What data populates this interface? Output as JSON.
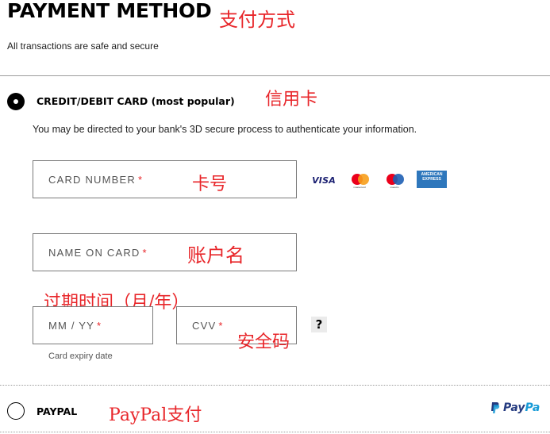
{
  "header": {
    "title": "PAYMENT METHOD",
    "title_annotation": "支付方式",
    "subtitle": "All transactions are safe and secure"
  },
  "credit_card_option": {
    "label": "CREDIT/DEBIT CARD (most popular)",
    "annotation": "信用卡",
    "selected": true,
    "note": "You may be directed to your bank's 3D secure process to authenticate your information."
  },
  "fields": {
    "card_number": {
      "placeholder": "CARD NUMBER",
      "required_mark": "*",
      "annotation": "卡号"
    },
    "name_on_card": {
      "placeholder": "NAME ON CARD",
      "required_mark": "*",
      "annotation": "账户名"
    },
    "expiry": {
      "placeholder": "MM / YY",
      "required_mark": "*",
      "annotation": "过期时间（月/年）",
      "caption": "Card expiry date"
    },
    "cvv": {
      "placeholder": "CVV",
      "required_mark": "*",
      "annotation": "安全码",
      "help_label": "?"
    }
  },
  "card_logos": {
    "visa": "VISA",
    "mastercard": "mastercard",
    "maestro": "maestro",
    "amex": "AMERICAN EXPRESS"
  },
  "paypal_option": {
    "label": "PAYPAL",
    "annotation": "PayPal支付",
    "selected": false,
    "logo_text_pay": "Pay",
    "logo_text_pal": "Pa"
  },
  "colors": {
    "annotation": "#e8262a",
    "required": "#e8262a",
    "visa": "#1a1f71",
    "mastercard_red": "#eb001b",
    "mastercard_orange": "#f79e1b",
    "amex": "#2e77bc",
    "paypal_dark": "#253b80",
    "paypal_light": "#179bd7"
  }
}
